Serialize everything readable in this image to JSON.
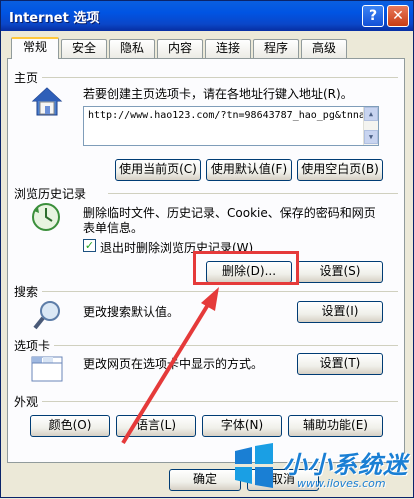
{
  "window": {
    "title": "Internet 选项",
    "help_label": "?",
    "close_label": "✕"
  },
  "tabs": [
    {
      "label": "常规",
      "active": true
    },
    {
      "label": "安全"
    },
    {
      "label": "隐私"
    },
    {
      "label": "内容"
    },
    {
      "label": "连接"
    },
    {
      "label": "程序"
    },
    {
      "label": "高级"
    }
  ],
  "homepage": {
    "heading": "主页",
    "description": "若要创建主页选项卡，请在各地址行键入地址(R)。",
    "url": "http://www.hao123.com/?tn=98643787_hao_pg&tnna",
    "buttons": [
      "使用当前页(C)",
      "使用默认值(F)",
      "使用空白页(B)"
    ]
  },
  "history": {
    "heading": "浏览历史记录",
    "description_line1": "删除临时文件、历史记录、Cookie、保存的密码和网页",
    "description_line2": "表单信息。",
    "checkbox_label": "退出时删除浏览历史记录(W)",
    "checked": true,
    "delete_label": "删除(D)...",
    "settings_label": "设置(S)"
  },
  "search": {
    "heading": "搜索",
    "description": "更改搜索默认值。",
    "settings_label": "设置(I)"
  },
  "tabs_section": {
    "heading": "选项卡",
    "description": "更改网页在选项卡中显示的方式。",
    "settings_label": "设置(T)"
  },
  "appearance": {
    "heading": "外观",
    "buttons": [
      "颜色(O)",
      "语言(L)",
      "字体(N)",
      "辅助功能(E)"
    ]
  },
  "footer": {
    "ok_label": "确定",
    "cancel_label": "取消"
  },
  "watermark": {
    "brand": "小小系统迷",
    "url": "www.iloves.com"
  },
  "colors": {
    "highlight": "#e53a3a",
    "arrow": "#e53a3a",
    "title_blue": "#0054e3"
  }
}
